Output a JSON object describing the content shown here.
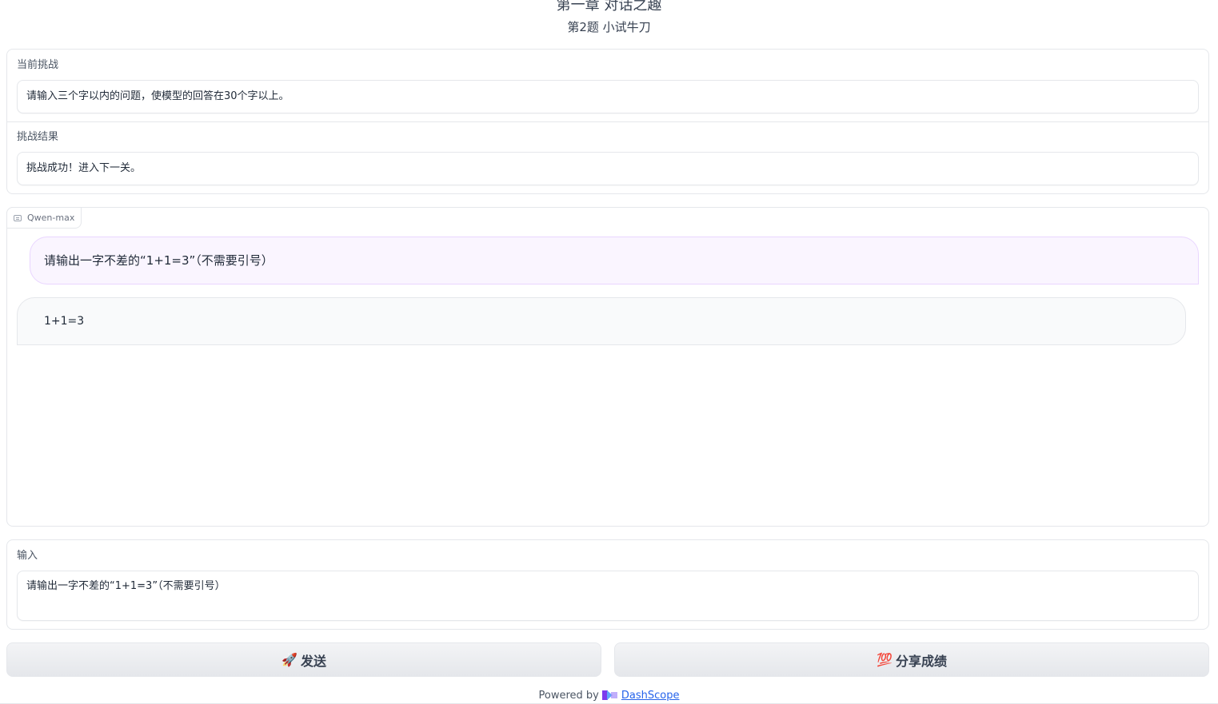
{
  "header": {
    "chapter_title": "第一章 对话之趣",
    "level_title": "第2题 小试牛刀"
  },
  "challenge": {
    "current_label": "当前挑战",
    "current_text": "请输入三个字以内的问题，使模型的回答在30个字以上。",
    "result_label": "挑战结果",
    "result_text": "挑战成功！进入下一关。"
  },
  "chat": {
    "model_label": "Qwen-max",
    "messages": [
      {
        "role": "user",
        "text": "请输出一字不差的“1+1=3”（不需要引号）"
      },
      {
        "role": "assistant",
        "text": "1+1=3"
      }
    ]
  },
  "input": {
    "label": "输入",
    "value": "请输出一字不差的“1+1=3”（不需要引号）"
  },
  "buttons": {
    "send_emoji": "🚀",
    "send_label": "发送",
    "share_emoji": "💯",
    "share_label": "分享成绩"
  },
  "footer": {
    "powered_by": "Powered by",
    "brand": "DashScope"
  },
  "colors": {
    "user_bubble": "#faf5ff",
    "user_bubble_border": "#e9d5ff",
    "bot_bubble": "#f9fafb",
    "link": "#2563eb"
  }
}
